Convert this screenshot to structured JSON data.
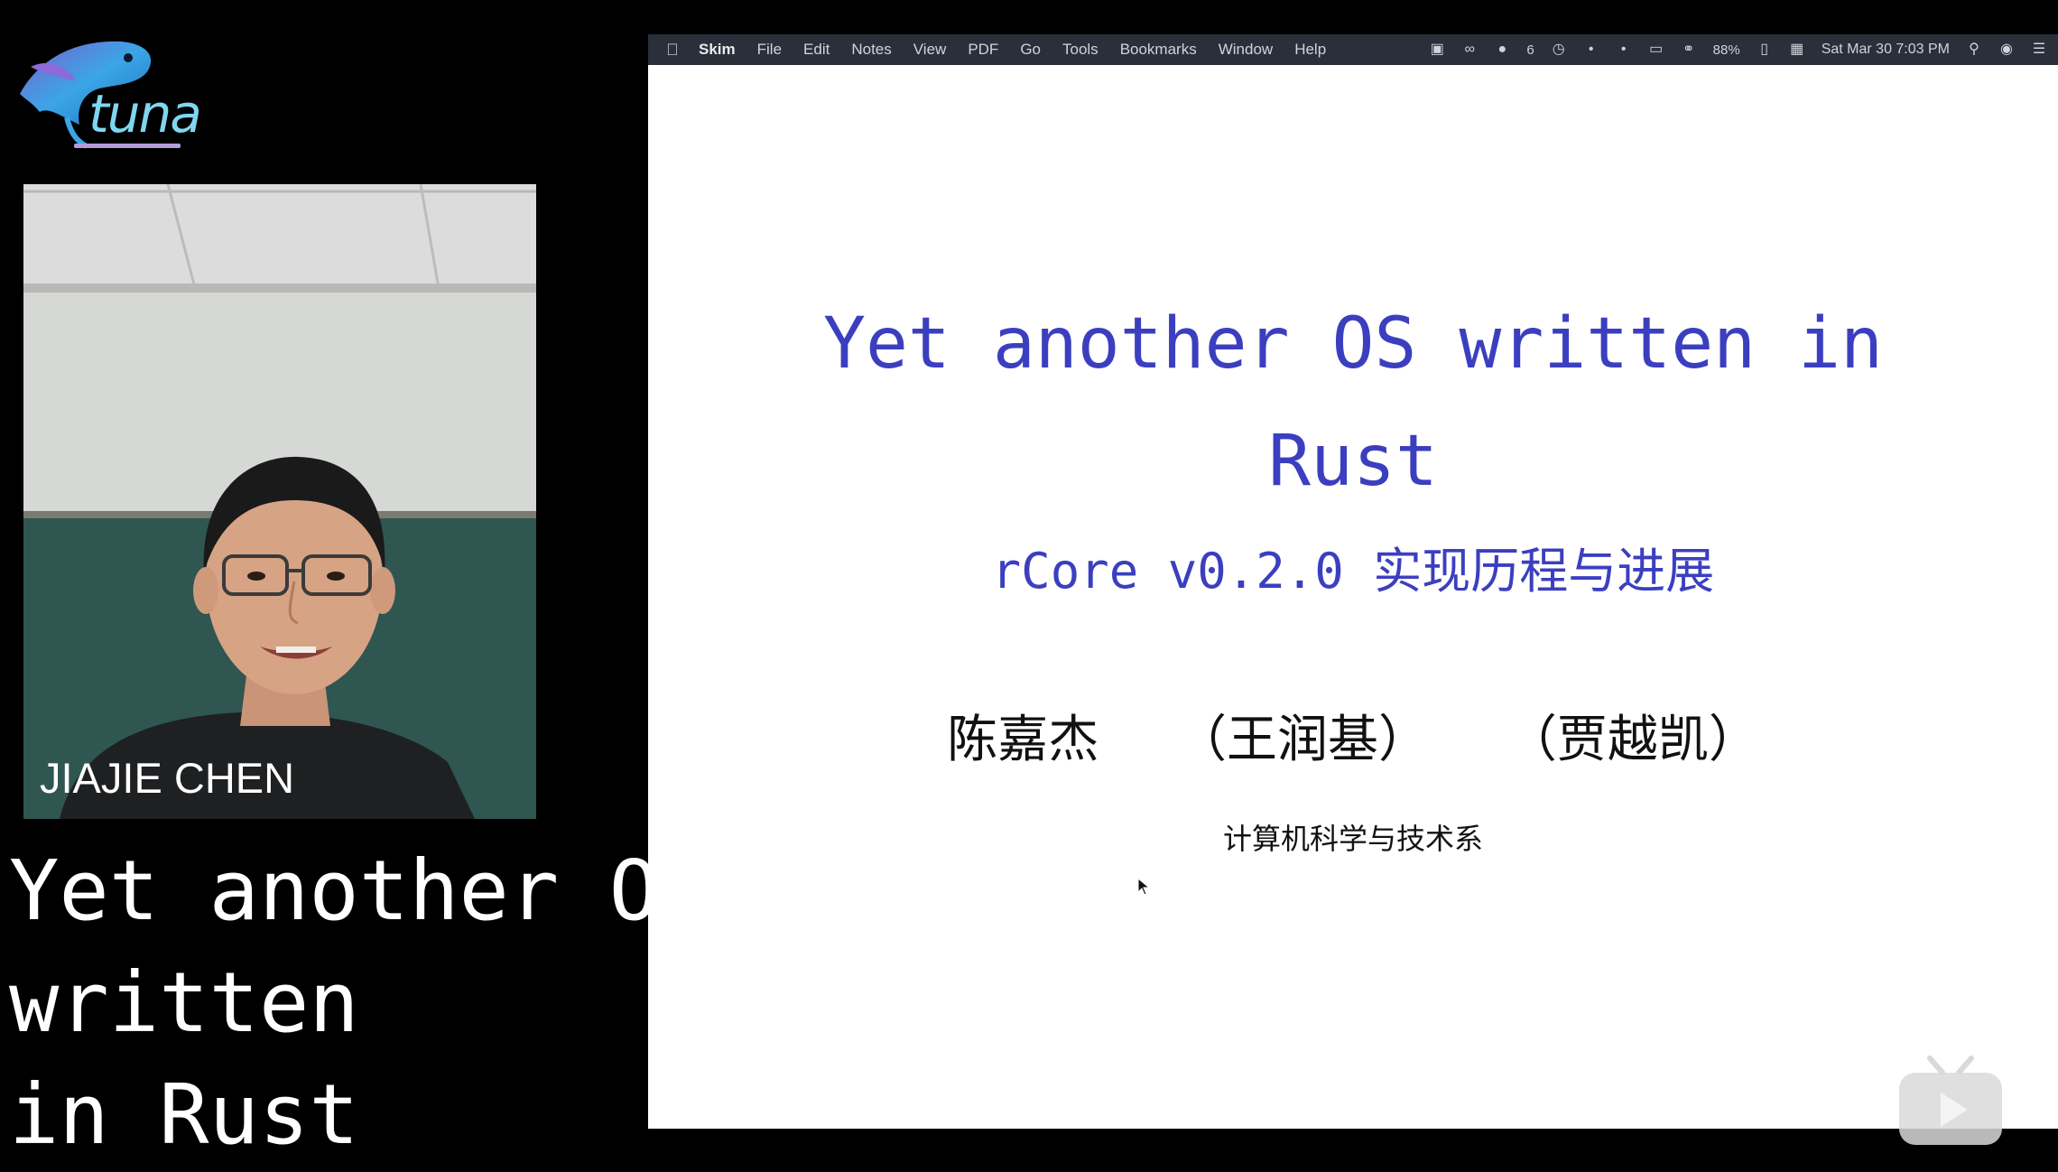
{
  "logo": {
    "text": "tuna",
    "icon": "fish-logo-icon"
  },
  "webcam": {
    "speaker_name": "JIAJIE CHEN"
  },
  "overlay_title": {
    "lines": [
      "Yet another OS",
      "written",
      "in Rust"
    ]
  },
  "menubar": {
    "apple_icon": "apple-icon",
    "items": [
      "Skim",
      "File",
      "Edit",
      "Notes",
      "View",
      "PDF",
      "Go",
      "Tools",
      "Bookmarks",
      "Window",
      "Help"
    ],
    "wechat_count": "6",
    "battery": "88%",
    "datetime": "Sat Mar 30  7:03 PM"
  },
  "slide": {
    "title_line1": "Yet another OS written in",
    "title_line2": "Rust",
    "subtitle": "rCore v0.2.0 实现历程与进展",
    "authors": [
      "陈嘉杰",
      "（王润基）",
      "（贾越凯）"
    ],
    "department": "计算机科学与技术系"
  },
  "colors": {
    "slide_title": "#3b3fbf",
    "menubar_bg": "#2a2f3a",
    "page_bg": "#000000"
  },
  "watermark": {
    "icon": "tv-play-icon"
  }
}
